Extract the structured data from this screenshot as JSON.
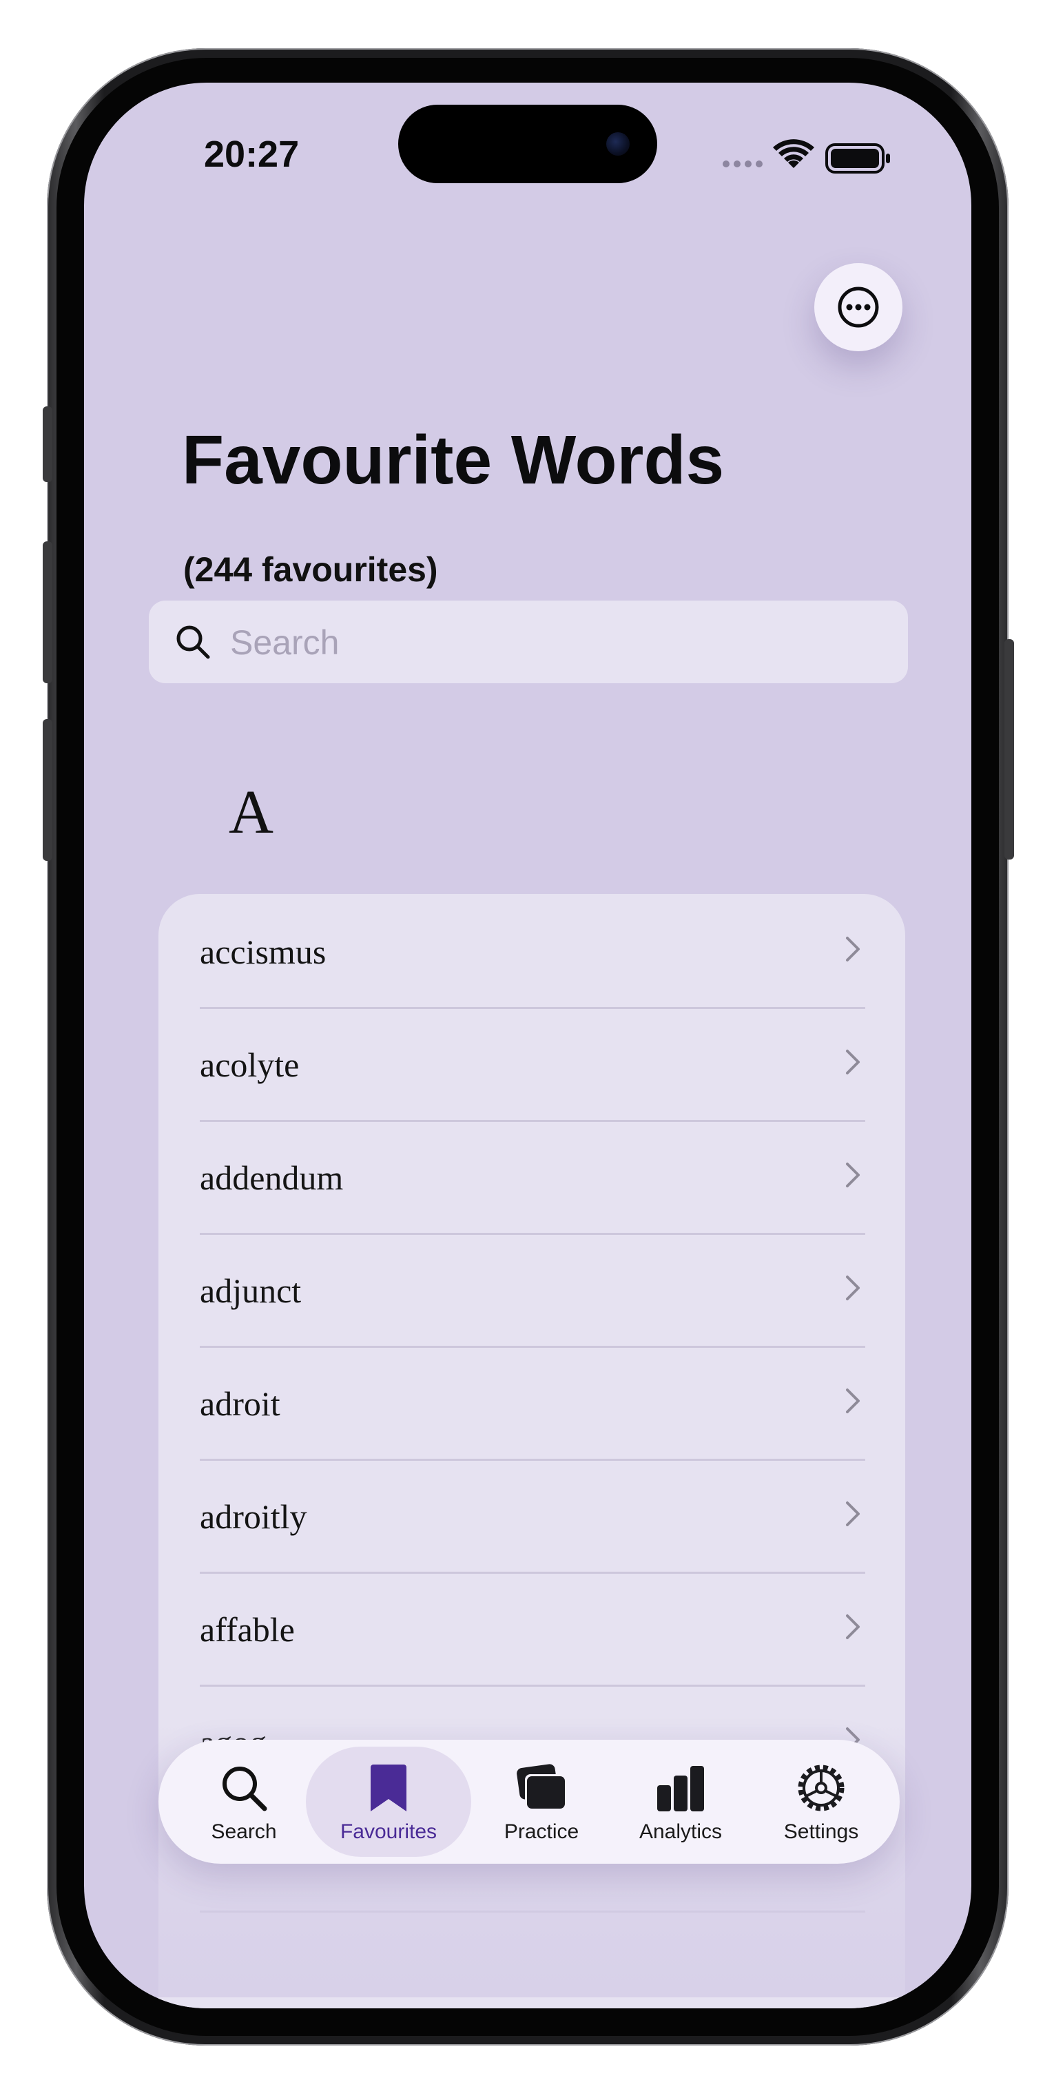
{
  "status_bar": {
    "time": "20:27"
  },
  "header": {
    "title": "Favourite Words",
    "count_text": "(244 favourites)"
  },
  "search": {
    "placeholder": "Search",
    "value": ""
  },
  "section": {
    "letter": "A"
  },
  "words": [
    "accismus",
    "acolyte",
    "addendum",
    "adjunct",
    "adroit",
    "adroitly",
    "affable",
    "agog"
  ],
  "tab_bar": {
    "tabs": [
      {
        "label": "Search",
        "icon": "search-icon",
        "active": false
      },
      {
        "label": "Favourites",
        "icon": "bookmark-icon",
        "active": true
      },
      {
        "label": "Practice",
        "icon": "cards-icon",
        "active": false
      },
      {
        "label": "Analytics",
        "icon": "bar-chart-icon",
        "active": false
      },
      {
        "label": "Settings",
        "icon": "gear-icon",
        "active": false
      }
    ]
  },
  "colors": {
    "background": "#d3cbe6",
    "accent": "#4a2b96",
    "card": "#e6e2f1"
  }
}
